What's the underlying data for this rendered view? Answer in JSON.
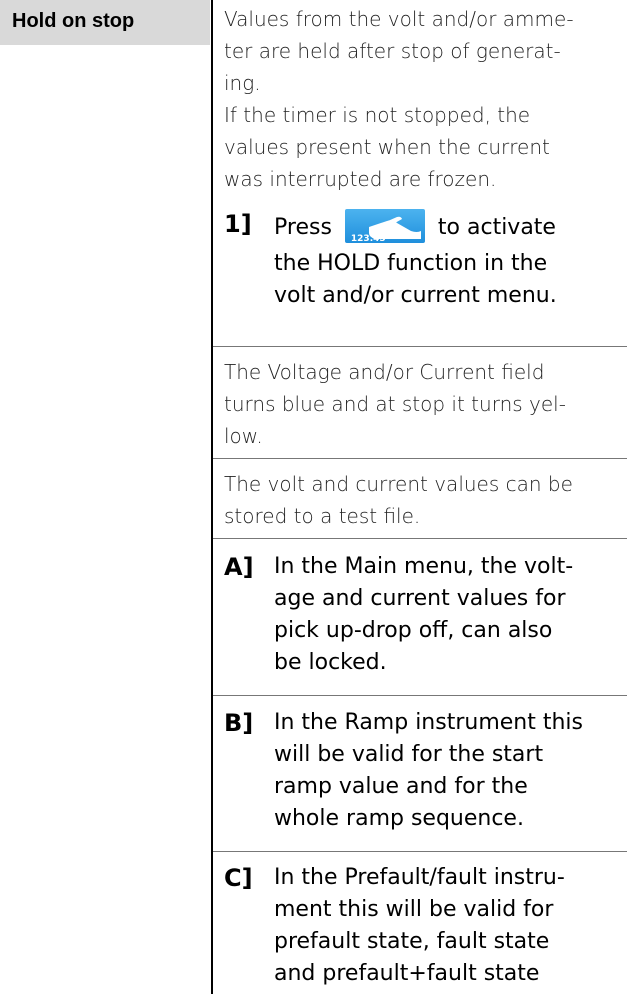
{
  "term": "Hold on stop",
  "intro_lines": [
    "Values from the volt and/or amme-",
    "ter are held after stop of generat-",
    "ing.",
    "If the timer is not stopped, the",
    "values present when the current",
    "was interrupted are frozen."
  ],
  "step1": {
    "marker": "1]",
    "lines": [
      "Press",
      "to activate",
      "the HOLD function in the",
      "volt and/or current menu."
    ],
    "icon_name": "hold-hand-icon",
    "icon_text": "123.45"
  },
  "blue_para": [
    "The Voltage and/or Current field",
    "turns blue and at stop it turns yel-",
    "low."
  ],
  "store_para": [
    "The volt and current values can be",
    "stored to a test file."
  ],
  "steps": [
    {
      "marker": "A]",
      "lines": [
        "In the Main menu, the volt-",
        "age and current values for",
        "pick up-drop off, can also",
        "be locked."
      ]
    },
    {
      "marker": "B]",
      "lines": [
        "In the Ramp instrument this",
        "will be valid for the start",
        "ramp value and for the",
        "whole ramp sequence."
      ]
    },
    {
      "marker": "C]",
      "lines": [
        "In the Prefault/fault instru-",
        "ment this will be valid for",
        "prefault state, fault state",
        "and prefault+fault state"
      ]
    }
  ]
}
